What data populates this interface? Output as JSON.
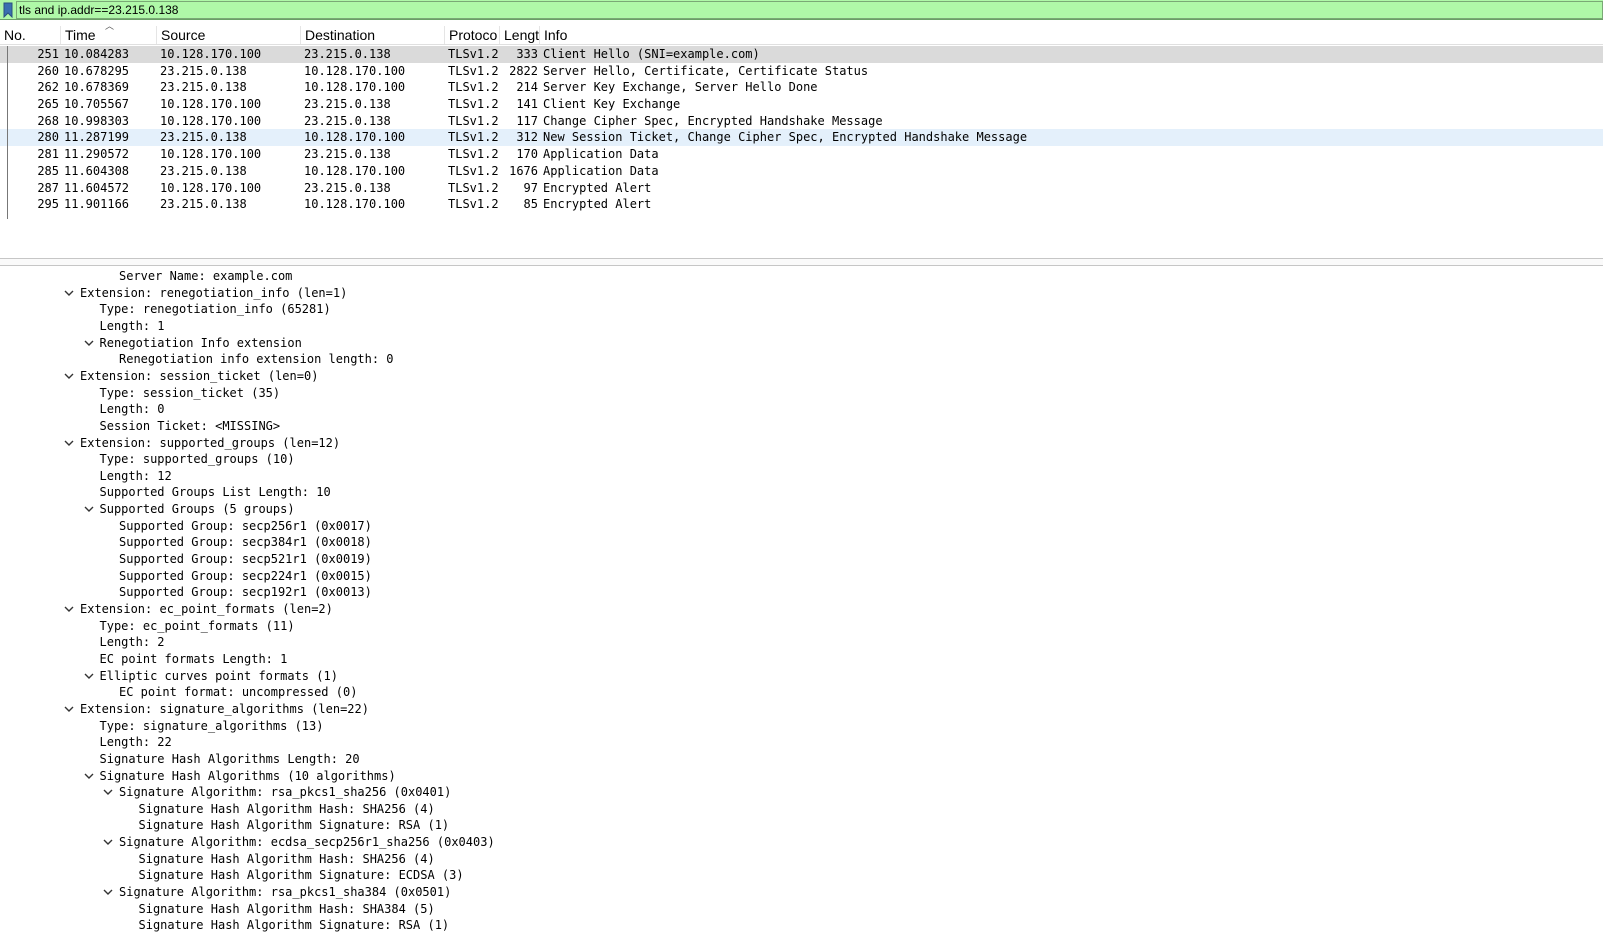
{
  "filter": {
    "value": "tls and ip.addr==23.215.0.138"
  },
  "columns": [
    "No.",
    "Time",
    "Source",
    "Destination",
    "Protoco",
    "Lengt",
    "Info"
  ],
  "packets": [
    {
      "no": "251",
      "time": "10.084283",
      "src": "10.128.170.100",
      "dst": "23.215.0.138",
      "proto": "TLSv1.2",
      "len": "333",
      "info": "Client Hello (SNI=example.com)"
    },
    {
      "no": "260",
      "time": "10.678295",
      "src": "23.215.0.138",
      "dst": "10.128.170.100",
      "proto": "TLSv1.2",
      "len": "2822",
      "info": "Server Hello, Certificate, Certificate Status"
    },
    {
      "no": "262",
      "time": "10.678369",
      "src": "23.215.0.138",
      "dst": "10.128.170.100",
      "proto": "TLSv1.2",
      "len": "214",
      "info": "Server Key Exchange, Server Hello Done"
    },
    {
      "no": "265",
      "time": "10.705567",
      "src": "10.128.170.100",
      "dst": "23.215.0.138",
      "proto": "TLSv1.2",
      "len": "141",
      "info": "Client Key Exchange"
    },
    {
      "no": "268",
      "time": "10.998303",
      "src": "10.128.170.100",
      "dst": "23.215.0.138",
      "proto": "TLSv1.2",
      "len": "117",
      "info": "Change Cipher Spec, Encrypted Handshake Message"
    },
    {
      "no": "280",
      "time": "11.287199",
      "src": "23.215.0.138",
      "dst": "10.128.170.100",
      "proto": "TLSv1.2",
      "len": "312",
      "info": "New Session Ticket, Change Cipher Spec, Encrypted Handshake Message"
    },
    {
      "no": "281",
      "time": "11.290572",
      "src": "10.128.170.100",
      "dst": "23.215.0.138",
      "proto": "TLSv1.2",
      "len": "170",
      "info": "Application Data"
    },
    {
      "no": "285",
      "time": "11.604308",
      "src": "23.215.0.138",
      "dst": "10.128.170.100",
      "proto": "TLSv1.2",
      "len": "1676",
      "info": "Application Data"
    },
    {
      "no": "287",
      "time": "11.604572",
      "src": "10.128.170.100",
      "dst": "23.215.0.138",
      "proto": "TLSv1.2",
      "len": "97",
      "info": "Encrypted Alert"
    },
    {
      "no": "295",
      "time": "11.901166",
      "src": "23.215.0.138",
      "dst": "10.128.170.100",
      "proto": "TLSv1.2",
      "len": "85",
      "info": "Encrypted Alert"
    }
  ],
  "details": [
    {
      "level": 3,
      "expander": false,
      "text": "Server Name: example.com"
    },
    {
      "level": 1,
      "expander": true,
      "text": "Extension: renegotiation_info (len=1)"
    },
    {
      "level": 2,
      "expander": false,
      "text": "Type: renegotiation_info (65281)"
    },
    {
      "level": 2,
      "expander": false,
      "text": "Length: 1"
    },
    {
      "level": 2,
      "expander": true,
      "text": "Renegotiation Info extension"
    },
    {
      "level": 3,
      "expander": false,
      "text": "Renegotiation info extension length: 0"
    },
    {
      "level": 1,
      "expander": true,
      "text": "Extension: session_ticket (len=0)"
    },
    {
      "level": 2,
      "expander": false,
      "text": "Type: session_ticket (35)"
    },
    {
      "level": 2,
      "expander": false,
      "text": "Length: 0"
    },
    {
      "level": 2,
      "expander": false,
      "text": "Session Ticket: <MISSING>"
    },
    {
      "level": 1,
      "expander": true,
      "text": "Extension: supported_groups (len=12)"
    },
    {
      "level": 2,
      "expander": false,
      "text": "Type: supported_groups (10)"
    },
    {
      "level": 2,
      "expander": false,
      "text": "Length: 12"
    },
    {
      "level": 2,
      "expander": false,
      "text": "Supported Groups List Length: 10"
    },
    {
      "level": 2,
      "expander": true,
      "text": "Supported Groups (5 groups)"
    },
    {
      "level": 3,
      "expander": false,
      "text": "Supported Group: secp256r1 (0x0017)"
    },
    {
      "level": 3,
      "expander": false,
      "text": "Supported Group: secp384r1 (0x0018)"
    },
    {
      "level": 3,
      "expander": false,
      "text": "Supported Group: secp521r1 (0x0019)"
    },
    {
      "level": 3,
      "expander": false,
      "text": "Supported Group: secp224r1 (0x0015)"
    },
    {
      "level": 3,
      "expander": false,
      "text": "Supported Group: secp192r1 (0x0013)"
    },
    {
      "level": 1,
      "expander": true,
      "text": "Extension: ec_point_formats (len=2)"
    },
    {
      "level": 2,
      "expander": false,
      "text": "Type: ec_point_formats (11)"
    },
    {
      "level": 2,
      "expander": false,
      "text": "Length: 2"
    },
    {
      "level": 2,
      "expander": false,
      "text": "EC point formats Length: 1"
    },
    {
      "level": 2,
      "expander": true,
      "text": "Elliptic curves point formats (1)"
    },
    {
      "level": 3,
      "expander": false,
      "text": "EC point format: uncompressed (0)"
    },
    {
      "level": 1,
      "expander": true,
      "text": "Extension: signature_algorithms (len=22)"
    },
    {
      "level": 2,
      "expander": false,
      "text": "Type: signature_algorithms (13)"
    },
    {
      "level": 2,
      "expander": false,
      "text": "Length: 22"
    },
    {
      "level": 2,
      "expander": false,
      "text": "Signature Hash Algorithms Length: 20"
    },
    {
      "level": 2,
      "expander": true,
      "text": "Signature Hash Algorithms (10 algorithms)"
    },
    {
      "level": 3,
      "expander": true,
      "text": "Signature Algorithm: rsa_pkcs1_sha256 (0x0401)"
    },
    {
      "level": 4,
      "expander": false,
      "text": "Signature Hash Algorithm Hash: SHA256 (4)"
    },
    {
      "level": 4,
      "expander": false,
      "text": "Signature Hash Algorithm Signature: RSA (1)"
    },
    {
      "level": 3,
      "expander": true,
      "text": "Signature Algorithm: ecdsa_secp256r1_sha256 (0x0403)"
    },
    {
      "level": 4,
      "expander": false,
      "text": "Signature Hash Algorithm Hash: SHA256 (4)"
    },
    {
      "level": 4,
      "expander": false,
      "text": "Signature Hash Algorithm Signature: ECDSA (3)"
    },
    {
      "level": 3,
      "expander": true,
      "text": "Signature Algorithm: rsa_pkcs1_sha384 (0x0501)"
    },
    {
      "level": 4,
      "expander": false,
      "text": "Signature Hash Algorithm Hash: SHA384 (5)"
    },
    {
      "level": 4,
      "expander": false,
      "text": "Signature Hash Algorithm Signature: RSA (1)"
    }
  ]
}
